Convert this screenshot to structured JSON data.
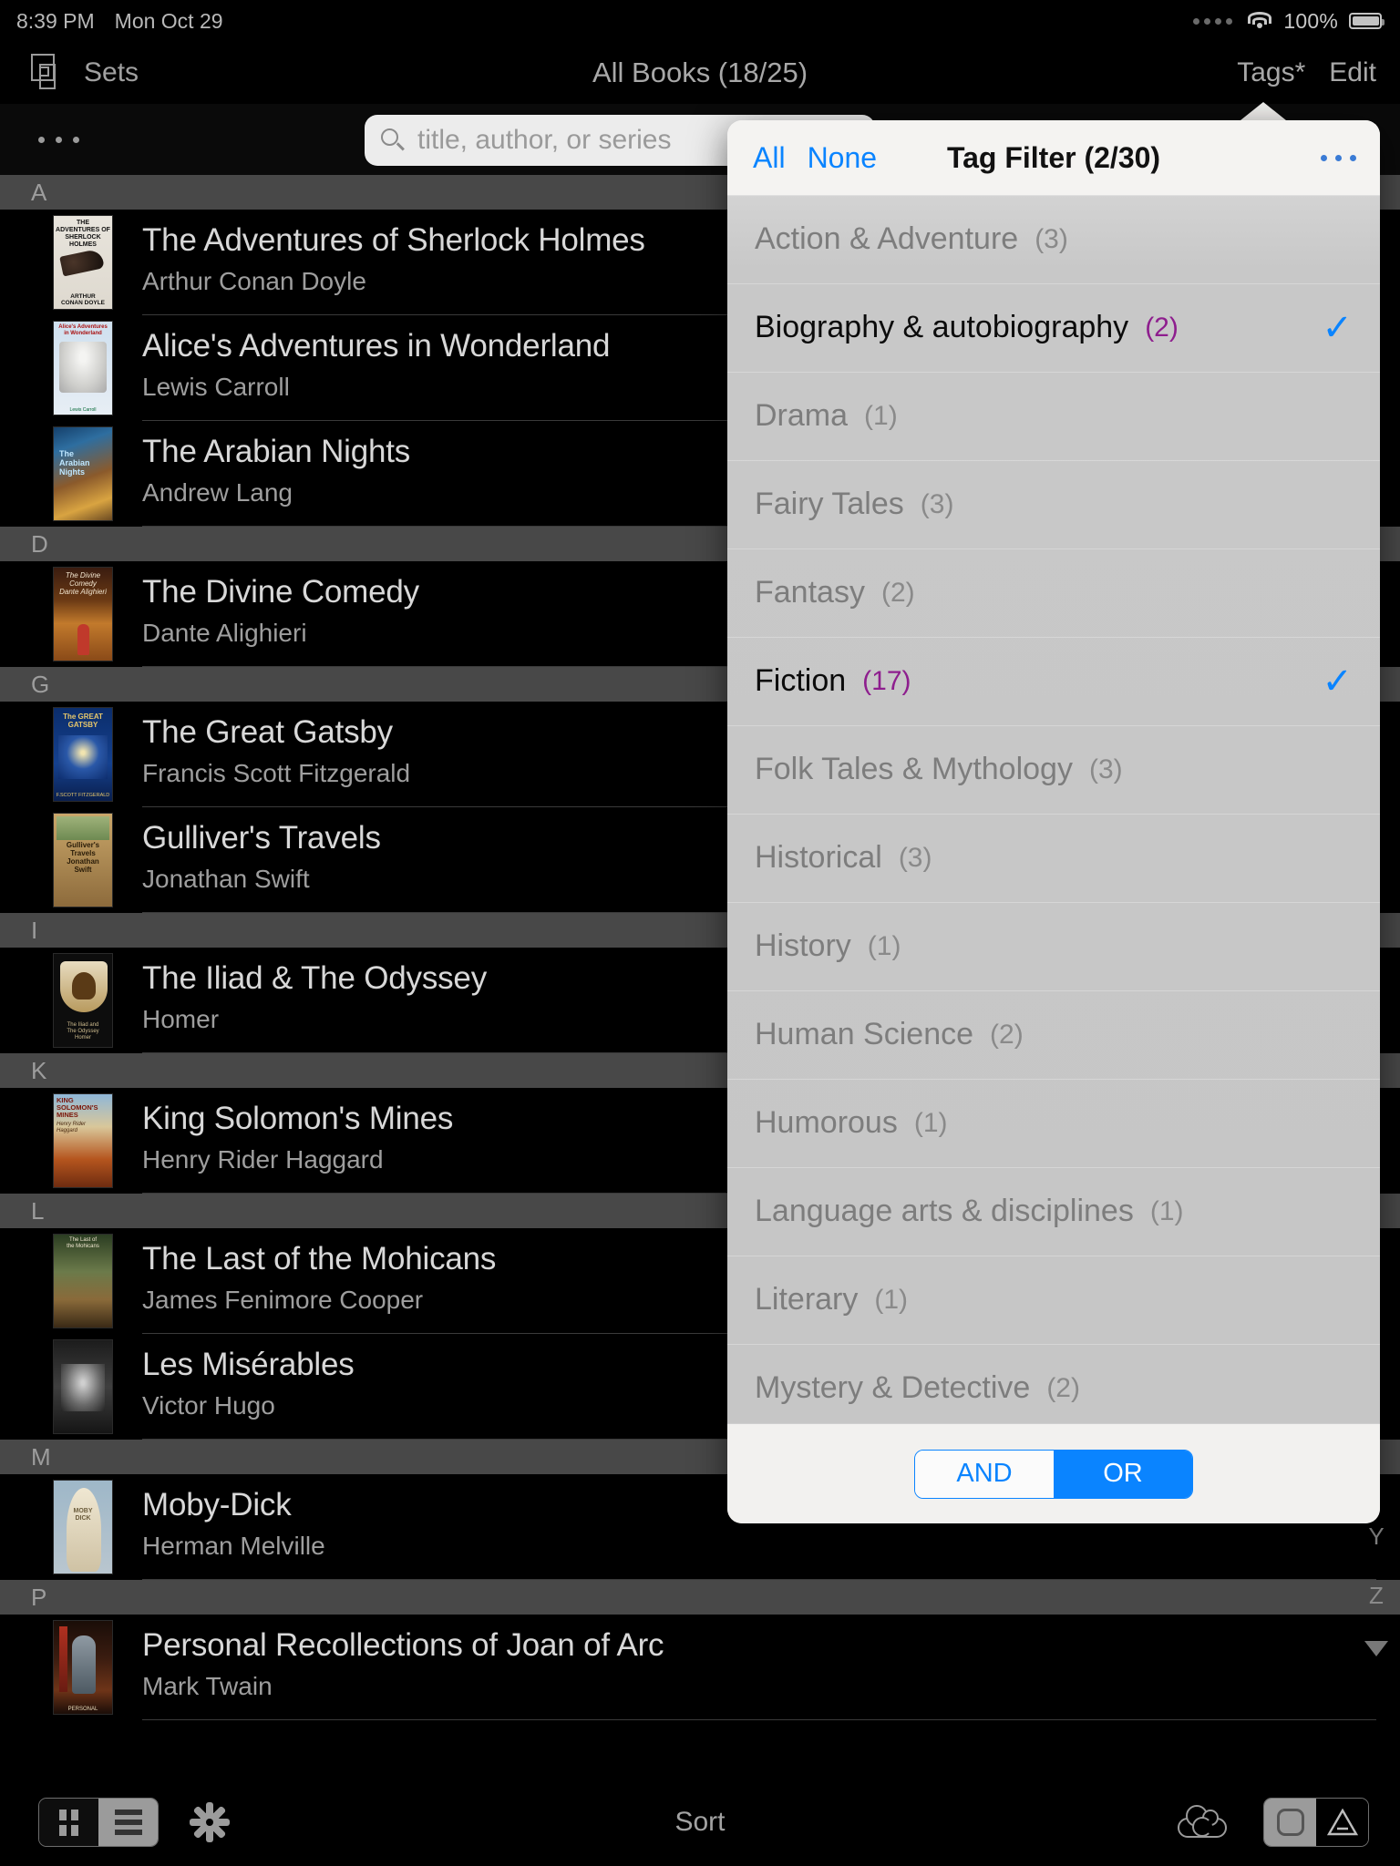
{
  "status_bar": {
    "time": "8:39 PM",
    "date": "Mon Oct 29",
    "battery_percent": "100%",
    "wifi_icon": "wifi-icon",
    "battery_icon": "battery-icon",
    "signal_icon": "signal-dots-icon"
  },
  "nav_bar": {
    "sets_label": "Sets",
    "sets_icon": "sets-icon",
    "title": "All Books (18/25)",
    "tags_label": "Tags*",
    "edit_label": "Edit"
  },
  "search": {
    "placeholder": "title, author, or series",
    "value": "",
    "search_icon": "search-icon",
    "more_icon": "more-dots-icon"
  },
  "book_list": {
    "sections": [
      {
        "letter": "A",
        "books": [
          {
            "title": "The Adventures of Sherlock Holmes",
            "author": "Arthur Conan Doyle",
            "cover": "cv-sherlock"
          },
          {
            "title": "Alice's Adventures in Wonderland",
            "author": "Lewis Carroll",
            "cover": "cv-alice"
          },
          {
            "title": "The Arabian Nights",
            "author": "Andrew Lang",
            "cover": "cv-arabian"
          }
        ]
      },
      {
        "letter": "D",
        "books": [
          {
            "title": "The Divine Comedy",
            "author": "Dante Alighieri",
            "cover": "cv-divine"
          }
        ]
      },
      {
        "letter": "G",
        "books": [
          {
            "title": "The Great Gatsby",
            "author": "Francis Scott Fitzgerald",
            "cover": "cv-gatsby"
          },
          {
            "title": "Gulliver's Travels",
            "author": "Jonathan Swift",
            "cover": "cv-gulliver"
          }
        ]
      },
      {
        "letter": "I",
        "books": [
          {
            "title": "The Iliad & The Odyssey",
            "author": "Homer",
            "cover": "cv-iliad"
          }
        ]
      },
      {
        "letter": "K",
        "books": [
          {
            "title": "King Solomon's Mines",
            "author": "Henry Rider Haggard",
            "cover": "cv-king"
          }
        ]
      },
      {
        "letter": "L",
        "books": [
          {
            "title": "The Last of the Mohicans",
            "author": "James Fenimore Cooper",
            "cover": "cv-mohicans"
          },
          {
            "title": "Les Misérables",
            "author": "Victor Hugo",
            "cover": "cv-lesmis"
          }
        ]
      },
      {
        "letter": "M",
        "books": [
          {
            "title": "Moby-Dick",
            "author": "Herman Melville",
            "cover": "cv-moby"
          }
        ]
      },
      {
        "letter": "P",
        "books": [
          {
            "title": "Personal Recollections of Joan of Arc",
            "author": "Mark Twain",
            "cover": "cv-joan"
          }
        ]
      }
    ]
  },
  "section_index": {
    "visible_letters": [
      "Y",
      "Z"
    ],
    "arrow_icon": "scroll-down-triangle-icon"
  },
  "tag_popover": {
    "all_label": "All",
    "none_label": "None",
    "title": "Tag Filter (2/30)",
    "more_icon": "more-dots-icon",
    "check_glyph": "✓",
    "selected_color": "#0a84ff",
    "count_selected_color": "#8e1e8e",
    "tags": [
      {
        "name": "Action & Adventure",
        "count": "(3)",
        "selected": false
      },
      {
        "name": "Biography & autobiography",
        "count": "(2)",
        "selected": true
      },
      {
        "name": "Drama",
        "count": "(1)",
        "selected": false
      },
      {
        "name": "Fairy Tales",
        "count": "(3)",
        "selected": false
      },
      {
        "name": "Fantasy",
        "count": "(2)",
        "selected": false
      },
      {
        "name": "Fiction",
        "count": "(17)",
        "selected": true
      },
      {
        "name": "Folk Tales & Mythology",
        "count": "(3)",
        "selected": false
      },
      {
        "name": "Historical",
        "count": "(3)",
        "selected": false
      },
      {
        "name": "History",
        "count": "(1)",
        "selected": false
      },
      {
        "name": "Human Science",
        "count": "(2)",
        "selected": false
      },
      {
        "name": "Humorous",
        "count": "(1)",
        "selected": false
      },
      {
        "name": "Language arts & disciplines",
        "count": "(1)",
        "selected": false
      },
      {
        "name": "Literary",
        "count": "(1)",
        "selected": false
      },
      {
        "name": "Mystery & Detective",
        "count": "(2)",
        "selected": false
      }
    ],
    "logic": {
      "and_label": "AND",
      "or_label": "OR",
      "active": "OR"
    }
  },
  "bottom_bar": {
    "view_mode": {
      "grid_icon": "grid-view-icon",
      "list_icon": "list-view-icon",
      "active": "grid"
    },
    "settings_icon": "gear-icon",
    "sort_label": "Sort",
    "cloud_sync_icon": "cloud-sync-icon",
    "display_mode": {
      "rounded_icon": "rounded-rect-icon",
      "triangle_icon": "triangle-icon",
      "active": "rounded"
    }
  }
}
